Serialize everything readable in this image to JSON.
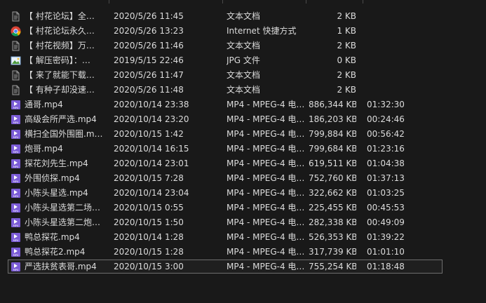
{
  "files": [
    {
      "name": "【 村花论坛】全…",
      "date": "2020/5/26 11:45",
      "type": "文本文档",
      "size": "2 KB",
      "duration": "",
      "icon": "text-file-icon"
    },
    {
      "name": "【 村花论坛永久…",
      "date": "2020/5/26 13:23",
      "type": "Internet 快捷方式",
      "size": "1 KB",
      "duration": "",
      "icon": "chrome-shortcut-icon"
    },
    {
      "name": "【 村花视频】万…",
      "date": "2020/5/26 11:46",
      "type": "文本文档",
      "size": "2 KB",
      "duration": "",
      "icon": "text-file-icon"
    },
    {
      "name": "【 解压密码】：…",
      "date": "2019/5/15 22:46",
      "type": "JPG 文件",
      "size": "0 KB",
      "duration": "",
      "icon": "image-file-icon"
    },
    {
      "name": "【 来了就能下载…",
      "date": "2020/5/26 11:47",
      "type": "文本文档",
      "size": "2 KB",
      "duration": "",
      "icon": "text-file-icon"
    },
    {
      "name": "【 有种子却没速…",
      "date": "2020/5/26 11:48",
      "type": "文本文档",
      "size": "2 KB",
      "duration": "",
      "icon": "text-file-icon"
    },
    {
      "name": "通哥.mp4",
      "date": "2020/10/14 23:38",
      "type": "MP4 - MPEG-4 电…",
      "size": "886,344 KB",
      "duration": "01:32:30",
      "icon": "mp4-file-icon"
    },
    {
      "name": "高级会所严选.mp4",
      "date": "2020/10/14 23:20",
      "type": "MP4 - MPEG-4 电…",
      "size": "186,203 KB",
      "duration": "00:24:46",
      "icon": "mp4-file-icon"
    },
    {
      "name": "横扫全国外围圈.m…",
      "date": "2020/10/15 1:42",
      "type": "MP4 - MPEG-4 电…",
      "size": "799,884 KB",
      "duration": "00:56:42",
      "icon": "mp4-file-icon"
    },
    {
      "name": "炮哥.mp4",
      "date": "2020/10/14 16:15",
      "type": "MP4 - MPEG-4 电…",
      "size": "799,684 KB",
      "duration": "01:23:16",
      "icon": "mp4-file-icon"
    },
    {
      "name": "探花刘先生.mp4",
      "date": "2020/10/14 23:01",
      "type": "MP4 - MPEG-4 电…",
      "size": "619,511 KB",
      "duration": "01:04:38",
      "icon": "mp4-file-icon"
    },
    {
      "name": "外围侦探.mp4",
      "date": "2020/10/15 7:28",
      "type": "MP4 - MPEG-4 电…",
      "size": "752,760 KB",
      "duration": "01:37:13",
      "icon": "mp4-file-icon"
    },
    {
      "name": "小陈头星选.mp4",
      "date": "2020/10/14 23:04",
      "type": "MP4 - MPEG-4 电…",
      "size": "322,662 KB",
      "duration": "01:03:25",
      "icon": "mp4-file-icon"
    },
    {
      "name": "小陈头星选第二场…",
      "date": "2020/10/15 0:55",
      "type": "MP4 - MPEG-4 电…",
      "size": "225,455 KB",
      "duration": "00:45:53",
      "icon": "mp4-file-icon"
    },
    {
      "name": "小陈头星选第二炮…",
      "date": "2020/10/15 1:50",
      "type": "MP4 - MPEG-4 电…",
      "size": "282,338 KB",
      "duration": "00:49:09",
      "icon": "mp4-file-icon"
    },
    {
      "name": "鸭总探花.mp4",
      "date": "2020/10/14 1:28",
      "type": "MP4 - MPEG-4 电…",
      "size": "526,353 KB",
      "duration": "01:39:22",
      "icon": "mp4-file-icon"
    },
    {
      "name": "鸭总探花2.mp4",
      "date": "2020/10/15 1:28",
      "type": "MP4 - MPEG-4 电…",
      "size": "317,739 KB",
      "duration": "01:01:10",
      "icon": "mp4-file-icon"
    },
    {
      "name": "严选扶贫表哥.mp4",
      "date": "2020/10/15 3:00",
      "type": "MP4 - MPEG-4 电…",
      "size": "755,254 KB",
      "duration": "01:18:48",
      "icon": "mp4-file-icon",
      "selected": true
    }
  ],
  "colors": {
    "background": "#191919",
    "text": "#dcdcdc",
    "mp4_icon": "#7b5cd6",
    "selection_border": "#6e6e6e"
  }
}
